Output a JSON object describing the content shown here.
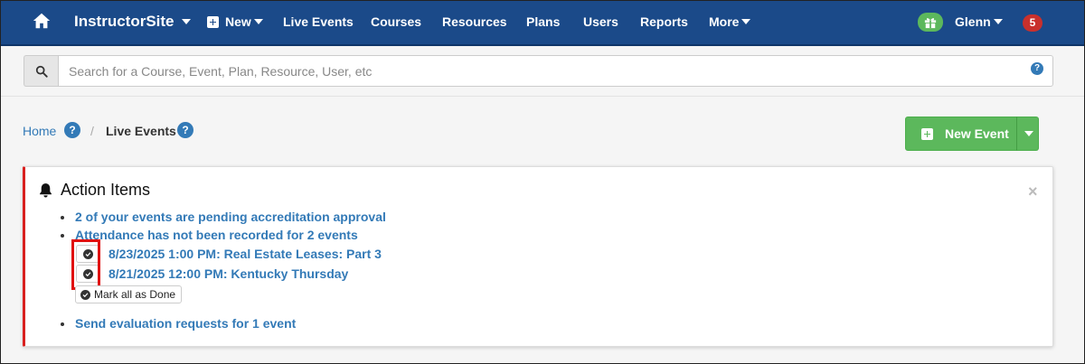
{
  "navbar": {
    "brand": "InstructorSite",
    "items": [
      {
        "label": "New",
        "has_caret": true
      },
      {
        "label": "Live Events"
      },
      {
        "label": "Courses"
      },
      {
        "label": "Resources"
      },
      {
        "label": "Plans"
      },
      {
        "label": "Users"
      },
      {
        "label": "Reports"
      },
      {
        "label": "More",
        "has_caret": true
      }
    ],
    "user": "Glenn",
    "notification_count": "5",
    "icons": {
      "home": "home-icon",
      "gift": "gift-icon",
      "new": "plus-square-icon"
    },
    "colors": {
      "background": "#1b4a89",
      "gift": "#5cb85c",
      "badge": "#c9302c"
    }
  },
  "search": {
    "placeholder": "Search for a Course, Event, Plan, Resource, User, etc",
    "value": "",
    "help_label": "?"
  },
  "breadcrumb": {
    "home": "Home",
    "separator": "/",
    "current": "Live Events",
    "help_label": "?"
  },
  "new_event_button": {
    "label": "New Event",
    "color": "#5cb85c"
  },
  "action_items": {
    "title": "Action Items",
    "close_label": "×",
    "accent_color": "#d9201f",
    "items": [
      {
        "text": "2 of your events are pending accreditation approval"
      },
      {
        "text": "Attendance has not been recorded for 2 events",
        "events": [
          {
            "text": "8/23/2025 1:00 PM: Real Estate Leases: Part 3"
          },
          {
            "text": "8/21/2025 12:00 PM: Kentucky Thursday"
          }
        ],
        "mark_all_label": "Mark all as Done"
      },
      {
        "text": "Send evaluation requests for 1 event"
      }
    ]
  },
  "annotation": {
    "highlight_color": "#e01010"
  }
}
